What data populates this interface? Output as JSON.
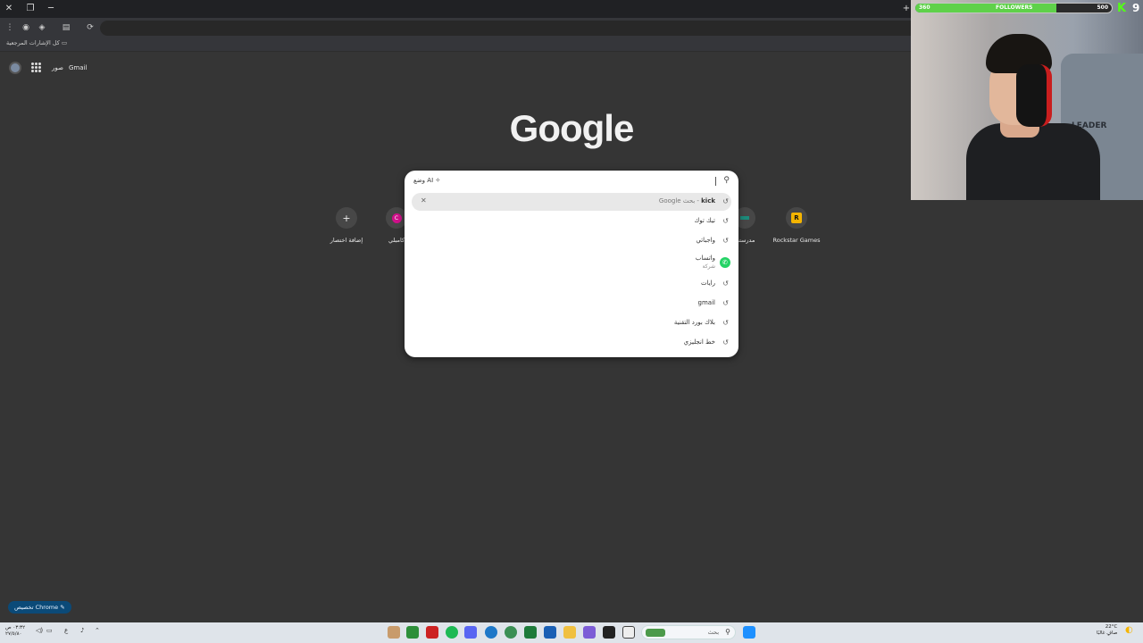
{
  "browser": {
    "new_tab_symbol": "+",
    "bookmarks_label": "كل الإشارات المرجعية"
  },
  "top_links": {
    "gmail": "Gmail",
    "images": "صور"
  },
  "logo_text": "Google",
  "search": {
    "ai_mode_label": "وضع AI",
    "suggestions": [
      {
        "text": "kick",
        "suffix": " - بحث Google",
        "highlighted": true
      },
      {
        "text": "تيك توك"
      },
      {
        "text": "واجباتي"
      },
      {
        "text": "واتساب",
        "subtitle": "شركة",
        "icon": "whatsapp-icon"
      },
      {
        "text": "رايات"
      },
      {
        "text": "gmail"
      },
      {
        "text": "بلاك بورد التقنية"
      },
      {
        "text": "خط انجليزي"
      }
    ]
  },
  "shortcuts": {
    "add": {
      "label": "إضافة اختصار",
      "symbol": "+"
    },
    "c_item": {
      "label": "كامبلي",
      "letter": "C"
    },
    "madrasati": {
      "label": "مدرستي"
    },
    "rockstar": {
      "label": "Rockstar Games",
      "letter": "R"
    }
  },
  "customize_label": "تخصيص Chrome",
  "taskbar": {
    "search_placeholder": "بحث",
    "clock_time": "٠٣:٣٢ ص",
    "clock_date": "٢٧/٥/٨٠",
    "weather_temp": "22°C",
    "weather_text": "صافٍ غالبًا",
    "lang": "ع"
  },
  "overlay": {
    "followers_label": "FOLLOWERS",
    "followers_current": "360",
    "followers_goal": "500",
    "followers_fraction": 0.72,
    "kick_letter": "K",
    "kick_count": "9",
    "chair_text": "LEADER"
  },
  "colors": {
    "page_bg": "#353535",
    "kick_green": "#53fc18",
    "customize_bg": "#0b4a78"
  }
}
